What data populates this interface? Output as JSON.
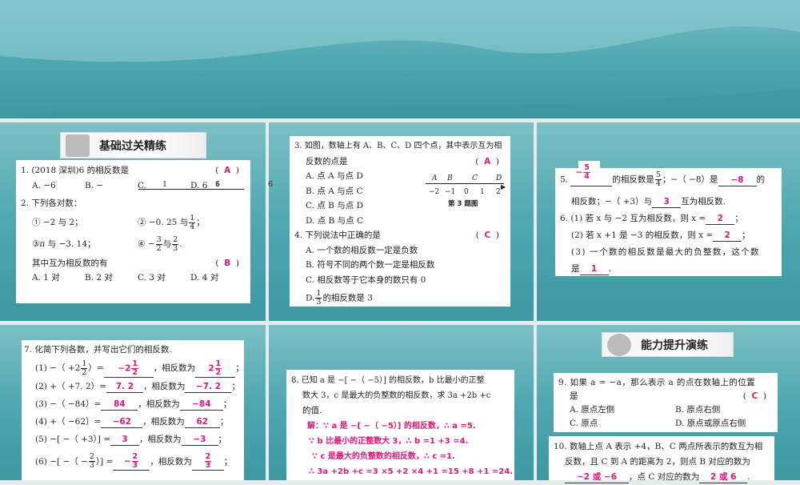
{
  "s1": {
    "title": "基础过关精练",
    "q1": {
      "stem": "1. (2018 深圳)6 的相反数是",
      "ans": "A",
      "a": "A. −6",
      "b": "B. −",
      "bn": "1",
      "bd": "6",
      "c": "C.",
      "cn": "1",
      "cd": "6",
      "d": "D. 6"
    },
    "q2": {
      "stem": "2. 下列各对数：",
      "i1": "① −2 与 2；",
      "i2a": "② −0. 25 与",
      "i2n": "1",
      "i2d": "4",
      "i2b": "；",
      "i3": "③π 与 −3. 14；",
      "i4a": "④ −",
      "i4n1": "3",
      "i4d1": "2",
      "i4b": "与",
      "i4n2": "2",
      "i4d2": "3",
      "i4c": ".",
      "ask": "其中互为相反数的有",
      "ans": "B",
      "opts": [
        "A. 1 对",
        "B. 2 对",
        "C. 3 对",
        "D. 4 对"
      ]
    }
  },
  "s2": {
    "q3": {
      "stem1": "3. 如图，数轴上有 A、B、C、D 四个点，其中表示互为相",
      "stem2": "反数的点是",
      "ans": "A",
      "opts": [
        "A. 点 A 与点 D",
        "B. 点 A 与点 C",
        "C. 点 B 与点 D",
        "D. 点 B 与点 C"
      ],
      "fig": {
        "points": [
          "A",
          "B",
          "C",
          "D"
        ],
        "ticks": [
          "−2",
          "−1",
          "0",
          "1",
          "2"
        ],
        "caption": "第 3 题图"
      }
    },
    "q4": {
      "stem": "4. 下列说法中正确的是",
      "ans": "C",
      "opts": [
        "A. 一个数的相反数一定是负数",
        "B. 符号不同的两个数一定是相反数",
        "C. 相反数等于它本身的数只有 0"
      ],
      "d_pre": "D.",
      "d_n": "1",
      "d_d": "3",
      "d_post": "的相反数是 3"
    }
  },
  "s3": {
    "q5": {
      "pre": "5.",
      "a1_sign": "−",
      "a1_n": "5",
      "a1_d": "4",
      "t1": "的相反数是",
      "fn": "5",
      "fd": "4",
      "t2": "；−（ −8）是",
      "a2": "−8",
      "t3": "的",
      "t4": "相反数；−（ +3）与",
      "a3": "3",
      "t5": "互为相反数."
    },
    "q6": {
      "l1": "6. (1) 若 x 与 −2 互为相反数，则 x =",
      "a1": "2",
      "l2": "(2) 若 x +1 是 −3 的相反数，则 x =",
      "a2": "2",
      "l3": "(3) 一个数的相反数是最大的负整数，这个数",
      "l4": "是",
      "a3": "1",
      "semi": "；",
      "dot": "."
    }
  },
  "s4": {
    "q7": {
      "stem": "7. 化简下列各数，并写出它们的相反数.",
      "mid": "，相反数为",
      "semi": "；",
      "r1": {
        "expr": "(1) −（ +2",
        "en": "1",
        "ed": "2",
        "expr2": "）=",
        "a": "−2",
        "an": "1",
        "ad": "2",
        "o": "2",
        "on": "1",
        "od": "2"
      },
      "r2": {
        "expr": "(2) +（ +7. 2）=",
        "a": "7. 2",
        "o": "−7. 2"
      },
      "r3": {
        "expr": "(3) −（ −84）=",
        "a": "84",
        "o": "−84"
      },
      "r4": {
        "expr": "(4) +（ −62）=",
        "a": "−62",
        "o": "62"
      },
      "r5": {
        "expr": "(5) −[ −（ +3）] =",
        "a": "3",
        "o": "−3"
      },
      "r6": {
        "expr": "(6) −[ −（ −",
        "en": "2",
        "ed": "3",
        "expr2": "）] =",
        "a": "−",
        "an": "2",
        "ad": "3",
        "on": "2",
        "od": "3"
      }
    }
  },
  "s5": {
    "q8": {
      "l1": "8. 已知 a 是 −[ −（ −5）] 的相反数，b 比最小的正整",
      "l2": "数大 3，c 是最大的负整数的相反数，求 3a +2b +c",
      "l3": "的值.",
      "s1": "解：∵ a 是 −[ −（ −5）] 的相反数，∴ a =5.",
      "s2": "∵ b 比最小的正整数大 3，∴ b =1 +3 =4.",
      "s3": "∵ c 是最大的负整数的相反数，∴ c =1.",
      "s4": "∴ 3a +2b +c =3 ×5 +2 ×4 +1 =15 +8 +1 =24."
    }
  },
  "s6": {
    "title": "能力提升演练",
    "q9": {
      "l1": "9. 如果 a = −a，那么表示 a 的点在数轴上的位置",
      "l2": "是",
      "ans": "C",
      "opts": [
        "A. 原点左侧",
        "B. 原点右侧",
        "C. 原点",
        "D. 原点或原点右侧"
      ]
    },
    "q10": {
      "l1": "10. 数轴上点 A 表示 +4，B、C 两点所表示的数互为相",
      "l2": "反数，且 C 到 A 的距离为 2，则点 B 对应的数为",
      "a1": "−2 或 −6",
      "mid": "，点 C 对应的数为",
      "a2": "2 或 6",
      "dot": "."
    }
  },
  "colors": {
    "answer": "#e0157f",
    "teal": "#4aa5ae"
  }
}
